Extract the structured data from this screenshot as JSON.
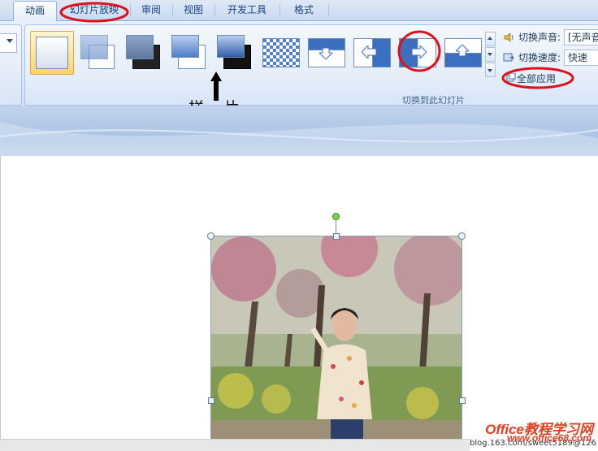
{
  "tabs": [
    {
      "label": "动画",
      "active": true
    },
    {
      "label": "幻灯片放映",
      "active": false
    },
    {
      "label": "审阅",
      "active": false
    },
    {
      "label": "视图",
      "active": false
    },
    {
      "label": "开发工具",
      "active": false
    },
    {
      "label": "格式",
      "active": false
    }
  ],
  "ribbon": {
    "group_label": "切换到此幻灯片",
    "gallery": [
      "无切换效果",
      "淡出",
      "淡出黑色",
      "剪切",
      "剪切黑色",
      "溶解",
      "向下擦除",
      "向左擦除",
      "向右擦除",
      "向上擦除"
    ],
    "sound_label": "切换声音:",
    "sound_value": "[无声音",
    "speed_label": "切换速度:",
    "speed_value": "快速",
    "apply_all_label": "全部应用"
  },
  "annotation": {
    "text1": "样",
    "text2": "片"
  },
  "footer": {
    "watermark": "Office教程学习网",
    "watermark_url": "www.office68.com",
    "blog_text": "blog.163.com/sweet5189@126"
  },
  "colors": {
    "accent_red": "#e0101a",
    "ribbon_blue": "#dbe7f6",
    "selected_gold": "#ffd36e"
  }
}
